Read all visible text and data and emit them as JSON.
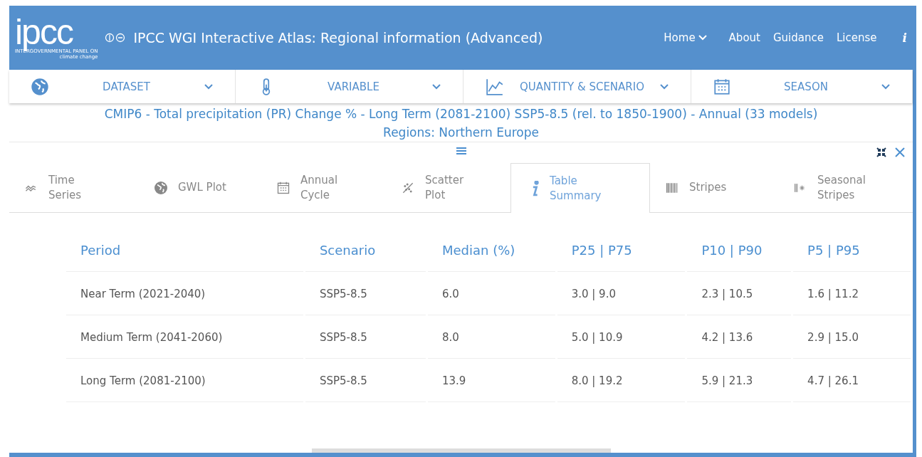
{
  "header": {
    "logo": "ipcc",
    "logo_sub_1": "INTERGOVERNMENTAL PANEL ON",
    "logo_sub_2": "climate change",
    "title": "IPCC WGI Interactive Atlas: Regional information (Advanced)",
    "nav": [
      {
        "label": "Home",
        "kind": "dropdown"
      },
      {
        "label": "About",
        "kind": "link"
      },
      {
        "label": "Guidance",
        "kind": "link"
      },
      {
        "label": "License",
        "kind": "link"
      },
      {
        "label": "i",
        "kind": "info"
      }
    ]
  },
  "toolbar": [
    {
      "label": "DATASET",
      "kind": "globe"
    },
    {
      "label": "VARIABLE",
      "kind": "thermometer"
    },
    {
      "label": "QUANTITY & SCENARIO",
      "kind": "chart"
    },
    {
      "label": "SEASON",
      "kind": "calendar"
    }
  ],
  "subtitle": [
    "CMIP6 - Total precipitation (PR) Change % - Long Term (2081-2100) SSP5-8.5 (rel. to 1850-1900) - Annual (33 models)",
    "Regions: Northern Europe"
  ],
  "tabs": [
    {
      "label": "Time Series",
      "kind": "wave",
      "selected": false
    },
    {
      "label": "GWL Plot",
      "kind": "globe",
      "selected": false
    },
    {
      "label": "Annual Cycle",
      "kind": "calendar",
      "selected": false
    },
    {
      "label": "Scatter Plot",
      "kind": "scatter",
      "selected": false
    },
    {
      "label": "Table Summary",
      "kind": "info",
      "selected": true
    },
    {
      "label": "Stripes",
      "kind": "stripes",
      "selected": false
    },
    {
      "label": "Seasonal Stripes",
      "kind": "seasonal",
      "selected": false
    }
  ],
  "table": {
    "columns": [
      "Period",
      "Scenario",
      "Median (%)",
      "P25 | P75",
      "P10 | P90",
      "P5 | P95"
    ],
    "rows": [
      [
        "Near Term (2021-2040)",
        "SSP5-8.5",
        "6.0",
        "3.0 | 9.0",
        "2.3 | 10.5",
        "1.6 | 11.2"
      ],
      [
        "Medium Term (2041-2060)",
        "SSP5-8.5",
        "8.0",
        "5.0 | 10.9",
        "4.2 | 13.6",
        "2.9 | 15.0"
      ],
      [
        "Long Term (2081-2100)",
        "SSP5-8.5",
        "13.9",
        "8.0 | 19.2",
        "5.9 | 21.3",
        "4.7 | 26.1"
      ]
    ]
  }
}
